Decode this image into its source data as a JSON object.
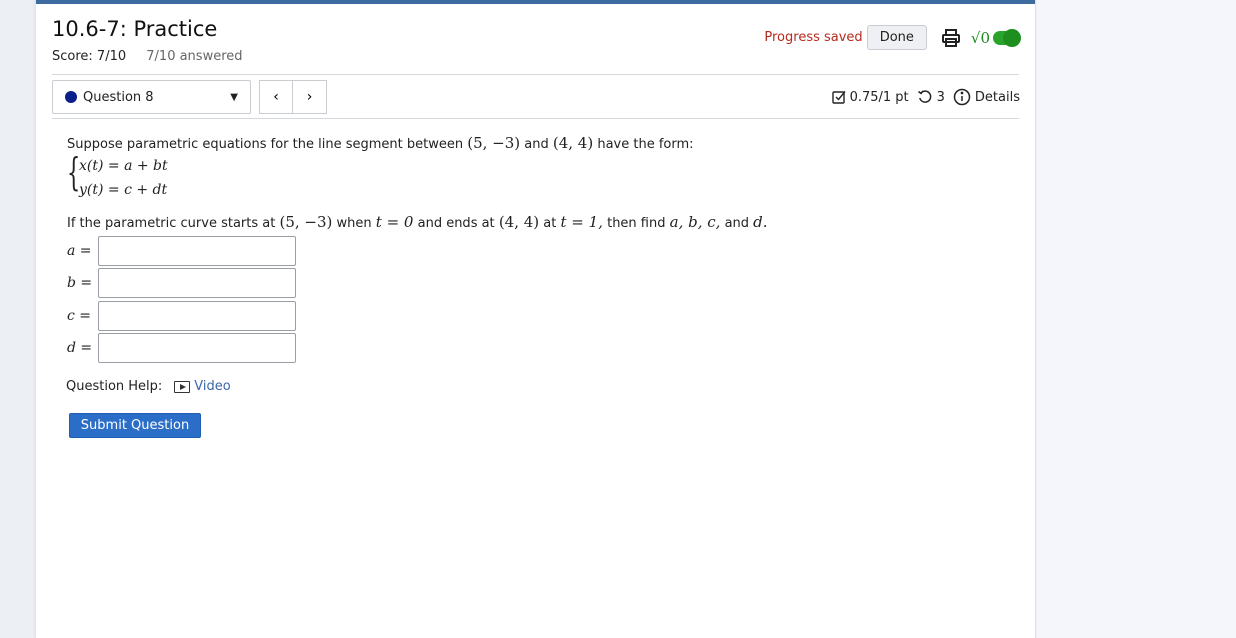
{
  "header": {
    "title": "10.6-7: Practice",
    "score": "Score: 7/10",
    "answered": "7/10 answered",
    "progress_text": "Progress saved",
    "done_label": "Done",
    "sqrt_label": "√0"
  },
  "nav": {
    "question_label": "Question 8",
    "prev": "‹",
    "next": "›",
    "points": "0.75/1 pt",
    "retries": "3",
    "details": "Details"
  },
  "question": {
    "intro_pre": "Suppose parametric equations for the line segment between",
    "p1": "(5, −3)",
    "and1": "and",
    "p2": "(4, 4)",
    "intro_post": "have the form:",
    "eq1": "x(t) = a + bt",
    "eq2": "y(t) = c + dt",
    "line2_a": "If the parametric curve starts at",
    "line2_p1": "(5, −3)",
    "line2_b": "when",
    "line2_t0": "t = 0",
    "line2_c": "and ends at",
    "line2_p2": "(4, 4)",
    "line2_d": "at",
    "line2_t1": "t = 1,",
    "line2_e": "then find",
    "line2_vars": "a, b, c,",
    "line2_f": "and",
    "line2_dvar": "d.",
    "fields": [
      {
        "label": "a =",
        "value": ""
      },
      {
        "label": "b =",
        "value": ""
      },
      {
        "label": "c =",
        "value": ""
      },
      {
        "label": "d =",
        "value": ""
      }
    ],
    "help_label": "Question Help:",
    "video_label": "Video",
    "submit_label": "Submit Question"
  },
  "colors": {
    "accent": "#2b6ec8",
    "progress": "#b52b1e",
    "toggle": "#29a329",
    "topbar": "#3d6ba0"
  }
}
